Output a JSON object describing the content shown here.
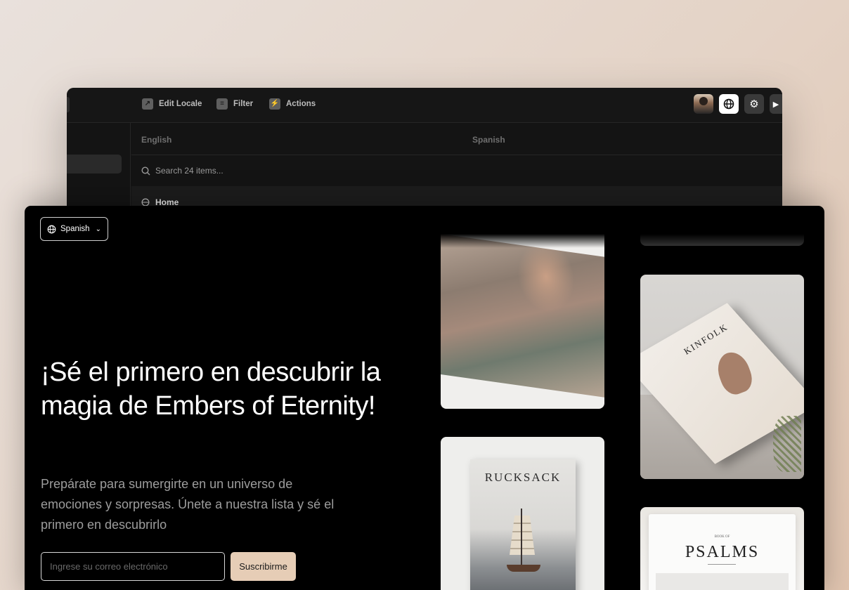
{
  "cms": {
    "toolbar": {
      "edit_locale": "Edit Locale",
      "filter": "Filter",
      "actions": "Actions"
    },
    "columns": {
      "english": "English",
      "spanish": "Spanish"
    },
    "search_placeholder": "Search 24 items...",
    "home_row": "Home"
  },
  "landing": {
    "language": "Spanish",
    "headline": "¡Sé el primero en descubrir la magia de Embers of Eternity!",
    "subtext": "Prepárate para sumergirte en un universo de emociones y sorpresas. Únete a nuestra lista y sé el primero en descubrirlo",
    "email_placeholder": "Ingrese su correo electrónico",
    "subscribe": "Suscribirme"
  },
  "gallery": {
    "kinfolk": "KINFOLK",
    "rucksack": "RUCKSACK",
    "psalms_small": "BOOK OF",
    "psalms": "PSALMS"
  },
  "colors": {
    "accent_button": "#e6cdb6",
    "landing_bg": "#000000",
    "cms_bg": "#141414"
  },
  "icons": [
    "edit-locale-icon",
    "filter-icon",
    "actions-icon",
    "globe-icon",
    "settings-icon",
    "play-icon",
    "search-icon",
    "chevron-down-icon"
  ]
}
